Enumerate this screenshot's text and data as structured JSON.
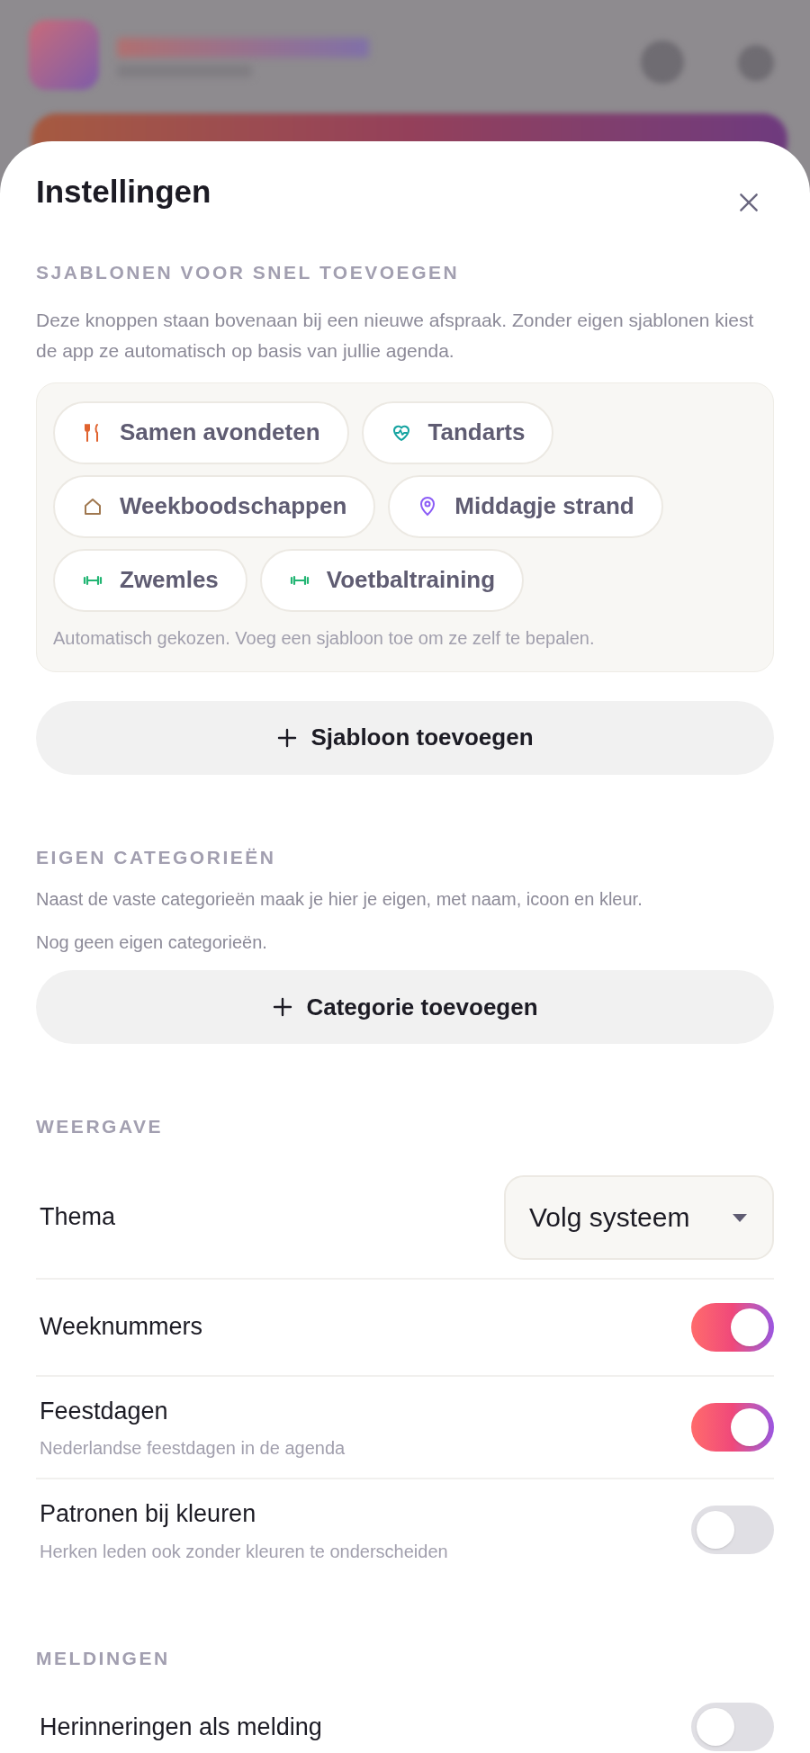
{
  "sheet": {
    "title": "Instellingen"
  },
  "templates": {
    "heading": "SJABLONEN VOOR SNEL TOEVOEGEN",
    "description": "Deze knoppen staan bovenaan bij een nieuwe afspraak. Zonder eigen sjablonen kiest de app ze automatisch op basis van jullie agenda.",
    "chips": [
      {
        "label": "Samen avondeten",
        "kind": "food",
        "color": "#e0622e"
      },
      {
        "label": "Tandarts",
        "kind": "health",
        "color": "#14a3a0"
      },
      {
        "label": "Weekboodschappen",
        "kind": "home",
        "color": "#a07850"
      },
      {
        "label": "Middagje strand",
        "kind": "pin",
        "color": "#8b5cf6"
      },
      {
        "label": "Zwemles",
        "kind": "sport",
        "color": "#22b573"
      },
      {
        "label": "Voetbaltraining",
        "kind": "sport",
        "color": "#22b573"
      }
    ],
    "note": "Automatisch gekozen. Voeg een sjabloon toe om ze zelf te bepalen.",
    "add_button": "Sjabloon toevoegen"
  },
  "categories": {
    "heading": "EIGEN CATEGORIEËN",
    "description": "Naast de vaste categorieën maak je hier je eigen, met naam, icoon en kleur.",
    "empty": "Nog geen eigen categorieën.",
    "add_button": "Categorie toevoegen"
  },
  "display": {
    "heading": "WEERGAVE",
    "theme": {
      "label": "Thema",
      "value": "Volg systeem"
    },
    "settings": [
      {
        "label": "Weeknummers",
        "on": true
      },
      {
        "label": "Feestdagen",
        "hint": "Nederlandse feestdagen in de agenda",
        "on": true
      },
      {
        "label": "Patronen bij kleuren",
        "hint": "Herken leden ook zonder kleuren te onderscheiden",
        "on": false
      }
    ]
  },
  "notifications": {
    "heading": "MELDINGEN",
    "settings": [
      {
        "label": "Herinneringen als melding",
        "on": false
      }
    ]
  }
}
